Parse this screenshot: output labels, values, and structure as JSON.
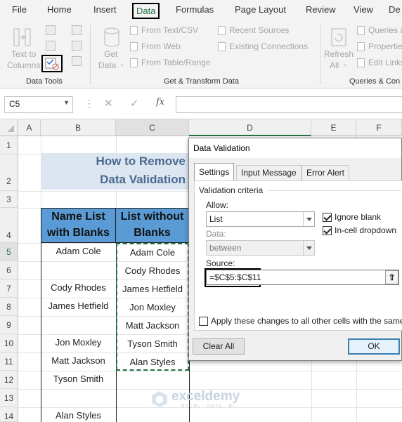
{
  "ribbon": {
    "tabs": [
      "File",
      "Home",
      "Insert",
      "Data",
      "Formulas",
      "Page Layout",
      "Review",
      "View",
      "De"
    ],
    "active_tab": "Data",
    "data_tools": {
      "text_to": "Text to",
      "columns": "Columns",
      "group_label": "Data Tools"
    },
    "get_data": {
      "get": "Get",
      "data": "Data",
      "from_text_csv": "From Text/CSV",
      "from_web": "From Web",
      "from_table_range": "From Table/Range",
      "recent_sources": "Recent Sources",
      "existing_connections": "Existing Connections",
      "group_label": "Get & Transform Data"
    },
    "queries": {
      "refresh": "Refresh",
      "all": "All",
      "queries_and": "Queries &",
      "properties": "Properties",
      "edit_links": "Edit Links",
      "group_label": "Queries & Con"
    }
  },
  "formula_bar": {
    "name_box": "C5",
    "fx": "fx"
  },
  "columns": [
    "A",
    "B",
    "C",
    "D",
    "E",
    "F"
  ],
  "rows": [
    "1",
    "2",
    "3",
    "4",
    "5",
    "6",
    "7",
    "8",
    "9",
    "10",
    "11",
    "12",
    "13",
    "14"
  ],
  "sheet": {
    "title_line1": "How to Remove",
    "title_line2": "Data Validation",
    "header_b_line1": "Name List",
    "header_b_line2": "with Blanks",
    "header_c_line1": "List without",
    "header_c_line2": "Blanks",
    "col_b": [
      "Adam Cole",
      "",
      "Cody Rhodes",
      "James Hetfield",
      "",
      "Jon Moxley",
      "Matt Jackson",
      "Tyson Smith",
      "",
      "Alan Styles"
    ],
    "col_c": [
      "Adam Cole",
      "Cody Rhodes",
      "James Hetfield",
      "Jon Moxley",
      "Matt Jackson",
      "Tyson Smith",
      "Alan Styles"
    ],
    "watermark": "exceldemy",
    "watermark_sub": "EXCEL · DATA · BI"
  },
  "dialog": {
    "title": "Data Validation",
    "tabs": [
      "Settings",
      "Input Message",
      "Error Alert"
    ],
    "validation_criteria": "Validation criteria",
    "allow_label": "Allow:",
    "allow_value": "List",
    "ignore_blank": "Ignore blank",
    "in_cell_dropdown": "In-cell dropdown",
    "data_label": "Data:",
    "data_value": "between",
    "source_label": "Source:",
    "source_value": "=$C$5:$C$11",
    "apply_changes": "Apply these changes to all other cells with the same s",
    "clear_all": "Clear All",
    "ok": "OK"
  }
}
